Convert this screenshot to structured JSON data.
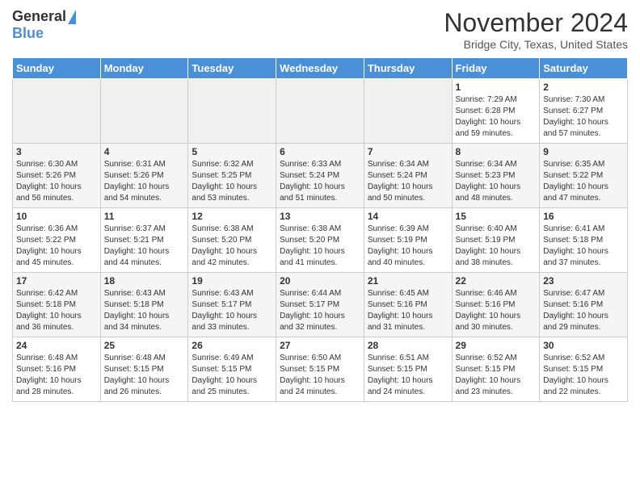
{
  "header": {
    "logo_general": "General",
    "logo_blue": "Blue",
    "month_title": "November 2024",
    "location": "Bridge City, Texas, United States"
  },
  "days_of_week": [
    "Sunday",
    "Monday",
    "Tuesday",
    "Wednesday",
    "Thursday",
    "Friday",
    "Saturday"
  ],
  "weeks": [
    [
      {
        "day": "",
        "info": ""
      },
      {
        "day": "",
        "info": ""
      },
      {
        "day": "",
        "info": ""
      },
      {
        "day": "",
        "info": ""
      },
      {
        "day": "",
        "info": ""
      },
      {
        "day": "1",
        "info": "Sunrise: 7:29 AM\nSunset: 6:28 PM\nDaylight: 10 hours and 59 minutes."
      },
      {
        "day": "2",
        "info": "Sunrise: 7:30 AM\nSunset: 6:27 PM\nDaylight: 10 hours and 57 minutes."
      }
    ],
    [
      {
        "day": "3",
        "info": "Sunrise: 6:30 AM\nSunset: 5:26 PM\nDaylight: 10 hours and 56 minutes."
      },
      {
        "day": "4",
        "info": "Sunrise: 6:31 AM\nSunset: 5:26 PM\nDaylight: 10 hours and 54 minutes."
      },
      {
        "day": "5",
        "info": "Sunrise: 6:32 AM\nSunset: 5:25 PM\nDaylight: 10 hours and 53 minutes."
      },
      {
        "day": "6",
        "info": "Sunrise: 6:33 AM\nSunset: 5:24 PM\nDaylight: 10 hours and 51 minutes."
      },
      {
        "day": "7",
        "info": "Sunrise: 6:34 AM\nSunset: 5:24 PM\nDaylight: 10 hours and 50 minutes."
      },
      {
        "day": "8",
        "info": "Sunrise: 6:34 AM\nSunset: 5:23 PM\nDaylight: 10 hours and 48 minutes."
      },
      {
        "day": "9",
        "info": "Sunrise: 6:35 AM\nSunset: 5:22 PM\nDaylight: 10 hours and 47 minutes."
      }
    ],
    [
      {
        "day": "10",
        "info": "Sunrise: 6:36 AM\nSunset: 5:22 PM\nDaylight: 10 hours and 45 minutes."
      },
      {
        "day": "11",
        "info": "Sunrise: 6:37 AM\nSunset: 5:21 PM\nDaylight: 10 hours and 44 minutes."
      },
      {
        "day": "12",
        "info": "Sunrise: 6:38 AM\nSunset: 5:20 PM\nDaylight: 10 hours and 42 minutes."
      },
      {
        "day": "13",
        "info": "Sunrise: 6:38 AM\nSunset: 5:20 PM\nDaylight: 10 hours and 41 minutes."
      },
      {
        "day": "14",
        "info": "Sunrise: 6:39 AM\nSunset: 5:19 PM\nDaylight: 10 hours and 40 minutes."
      },
      {
        "day": "15",
        "info": "Sunrise: 6:40 AM\nSunset: 5:19 PM\nDaylight: 10 hours and 38 minutes."
      },
      {
        "day": "16",
        "info": "Sunrise: 6:41 AM\nSunset: 5:18 PM\nDaylight: 10 hours and 37 minutes."
      }
    ],
    [
      {
        "day": "17",
        "info": "Sunrise: 6:42 AM\nSunset: 5:18 PM\nDaylight: 10 hours and 36 minutes."
      },
      {
        "day": "18",
        "info": "Sunrise: 6:43 AM\nSunset: 5:18 PM\nDaylight: 10 hours and 34 minutes."
      },
      {
        "day": "19",
        "info": "Sunrise: 6:43 AM\nSunset: 5:17 PM\nDaylight: 10 hours and 33 minutes."
      },
      {
        "day": "20",
        "info": "Sunrise: 6:44 AM\nSunset: 5:17 PM\nDaylight: 10 hours and 32 minutes."
      },
      {
        "day": "21",
        "info": "Sunrise: 6:45 AM\nSunset: 5:16 PM\nDaylight: 10 hours and 31 minutes."
      },
      {
        "day": "22",
        "info": "Sunrise: 6:46 AM\nSunset: 5:16 PM\nDaylight: 10 hours and 30 minutes."
      },
      {
        "day": "23",
        "info": "Sunrise: 6:47 AM\nSunset: 5:16 PM\nDaylight: 10 hours and 29 minutes."
      }
    ],
    [
      {
        "day": "24",
        "info": "Sunrise: 6:48 AM\nSunset: 5:16 PM\nDaylight: 10 hours and 28 minutes."
      },
      {
        "day": "25",
        "info": "Sunrise: 6:48 AM\nSunset: 5:15 PM\nDaylight: 10 hours and 26 minutes."
      },
      {
        "day": "26",
        "info": "Sunrise: 6:49 AM\nSunset: 5:15 PM\nDaylight: 10 hours and 25 minutes."
      },
      {
        "day": "27",
        "info": "Sunrise: 6:50 AM\nSunset: 5:15 PM\nDaylight: 10 hours and 24 minutes."
      },
      {
        "day": "28",
        "info": "Sunrise: 6:51 AM\nSunset: 5:15 PM\nDaylight: 10 hours and 24 minutes."
      },
      {
        "day": "29",
        "info": "Sunrise: 6:52 AM\nSunset: 5:15 PM\nDaylight: 10 hours and 23 minutes."
      },
      {
        "day": "30",
        "info": "Sunrise: 6:52 AM\nSunset: 5:15 PM\nDaylight: 10 hours and 22 minutes."
      }
    ]
  ]
}
